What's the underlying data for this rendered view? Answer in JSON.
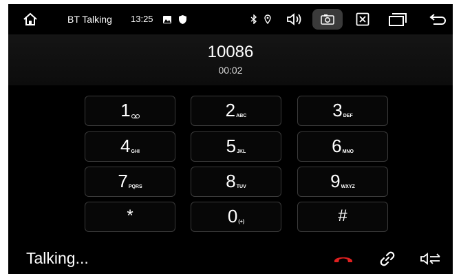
{
  "statusbar": {
    "app_title": "BT Talking",
    "time": "13:25",
    "icons": [
      "home-icon",
      "image-icon",
      "shield-icon",
      "bluetooth-icon",
      "location-icon",
      "volume-icon",
      "screenshot-icon",
      "close-box-icon",
      "recent-apps-icon",
      "back-icon"
    ]
  },
  "call": {
    "number": "10086",
    "duration": "00:02"
  },
  "keypad": {
    "keys": [
      {
        "digit": "1",
        "letters": ""
      },
      {
        "digit": "2",
        "letters": "ABC"
      },
      {
        "digit": "3",
        "letters": "DEF"
      },
      {
        "digit": "4",
        "letters": "GHI"
      },
      {
        "digit": "5",
        "letters": "JKL"
      },
      {
        "digit": "6",
        "letters": "MNO"
      },
      {
        "digit": "7",
        "letters": "PQRS"
      },
      {
        "digit": "8",
        "letters": "TUV"
      },
      {
        "digit": "9",
        "letters": "WXYZ"
      },
      {
        "digit": "*",
        "letters": ""
      },
      {
        "digit": "0",
        "letters": "(+)"
      },
      {
        "digit": "#",
        "letters": ""
      }
    ]
  },
  "bottom": {
    "status": "Talking...",
    "hangup_color": "#e02020"
  },
  "colors": {
    "background": "#000000",
    "key_border": "#3a3a3a",
    "text": "#ffffff"
  }
}
